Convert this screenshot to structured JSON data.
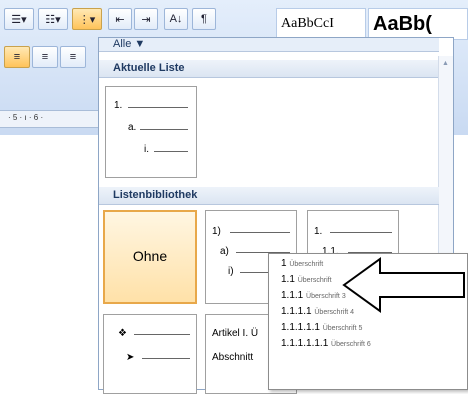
{
  "toolbar": {
    "style_sample_1": "AaBbCcI",
    "style_sample_2": "AaBb("
  },
  "ruler": {
    "marks": "· 5 · ı · 6 ·"
  },
  "panel": {
    "dropdown_label": "Alle ▼",
    "section_current": "Aktuelle Liste",
    "section_library": "Listenbibliothek",
    "current_list": {
      "level1": "1.",
      "level2": "a.",
      "level3": "i."
    },
    "library": {
      "none_label": "Ohne",
      "numbered_paren": {
        "l1": "1)",
        "l2": "a)",
        "l3": "i)"
      },
      "numbered_outline": {
        "l1": "1.",
        "l2": "1.1."
      },
      "bullet": {
        "l1": "❖",
        "l2": "➤"
      },
      "article": {
        "l1": "Artikel I. Ü",
        "l2": "Abschnitt"
      }
    }
  },
  "tooltip": {
    "rows": [
      {
        "num": "1",
        "text": "Überschrift"
      },
      {
        "num": "1.1",
        "text": "Überschrift"
      },
      {
        "num": "1.1.1",
        "text": "Überschrift 3"
      },
      {
        "num": "1.1.1.1",
        "text": "Überschrift 4"
      },
      {
        "num": "1.1.1.1.1",
        "text": "Überschrift 5"
      },
      {
        "num": "1.1.1.1.1.1",
        "text": "Überschrift 6"
      }
    ]
  },
  "colors": {
    "accent_selected": "#ffc35a",
    "panel_header": "#dbe5f2"
  }
}
